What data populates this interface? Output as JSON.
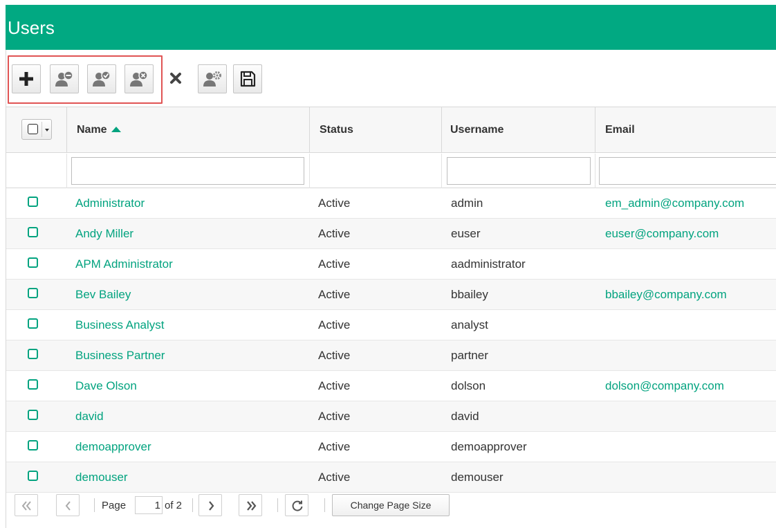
{
  "page": {
    "title": "Users"
  },
  "toolbar": {
    "buttons": [
      {
        "name": "add-user",
        "icon": "plus-icon"
      },
      {
        "name": "remove-from-group",
        "icon": "user-minus-icon"
      },
      {
        "name": "activate-user",
        "icon": "user-check-icon"
      },
      {
        "name": "deactivate-user",
        "icon": "user-x-icon"
      },
      {
        "name": "delete",
        "icon": "close-icon"
      },
      {
        "name": "user-settings",
        "icon": "user-gear-icon"
      },
      {
        "name": "save",
        "icon": "save-icon"
      }
    ]
  },
  "table": {
    "columns": [
      {
        "key": "name",
        "label": "Name",
        "sorted": "asc"
      },
      {
        "key": "status",
        "label": "Status"
      },
      {
        "key": "username",
        "label": "Username"
      },
      {
        "key": "email",
        "label": "Email"
      }
    ],
    "rows": [
      {
        "name": "Administrator",
        "status": "Active",
        "username": "admin",
        "email": "em_admin@company.com"
      },
      {
        "name": "Andy Miller",
        "status": "Active",
        "username": "euser",
        "email": "euser@company.com"
      },
      {
        "name": "APM Administrator",
        "status": "Active",
        "username": "aadministrator",
        "email": ""
      },
      {
        "name": "Bev Bailey",
        "status": "Active",
        "username": "bbailey",
        "email": "bbailey@company.com"
      },
      {
        "name": "Business Analyst",
        "status": "Active",
        "username": "analyst",
        "email": ""
      },
      {
        "name": "Business Partner",
        "status": "Active",
        "username": "partner",
        "email": ""
      },
      {
        "name": "Dave Olson",
        "status": "Active",
        "username": "dolson",
        "email": "dolson@company.com"
      },
      {
        "name": "david",
        "status": "Active",
        "username": "david",
        "email": ""
      },
      {
        "name": "demoapprover",
        "status": "Active",
        "username": "demoapprover",
        "email": ""
      },
      {
        "name": "demouser",
        "status": "Active",
        "username": "demouser",
        "email": ""
      }
    ]
  },
  "pager": {
    "page_label": "Page",
    "current_page": "1",
    "of_label": "of 2",
    "change_page_size_label": "Change Page Size"
  },
  "colors": {
    "accent": "#01a982",
    "link": "#02a37f",
    "highlight": "#e05454"
  }
}
